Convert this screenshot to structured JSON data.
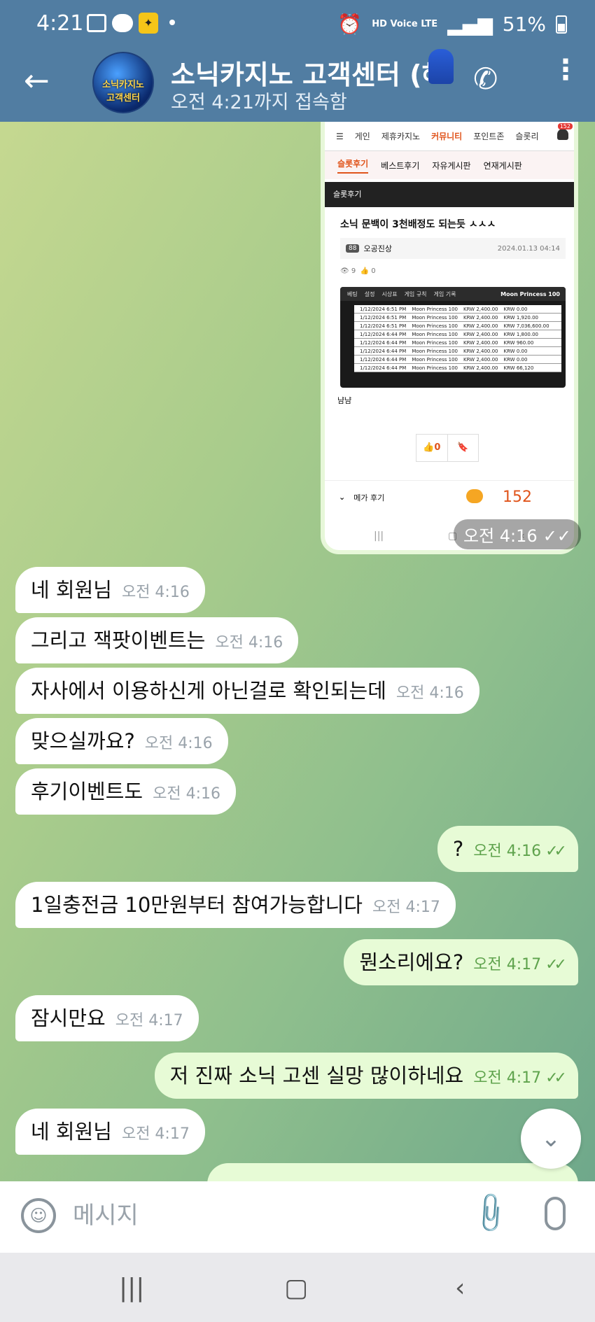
{
  "status_bar": {
    "time": "4:21",
    "network": "HD Voice LTE",
    "battery": "51%"
  },
  "header": {
    "back_icon": "arrow-left-icon",
    "avatar_text": "소닉카지노 고객센터",
    "title": "소닉카지노 고객센터 (해",
    "subtitle": "오전 4:21까지 접속함"
  },
  "shared_screenshot": {
    "nav_items": [
      "게인",
      "제휴카지노",
      "커뮤니티",
      "포인트존",
      "슬롯리"
    ],
    "nav_active": "커뮤니티",
    "notif_count": "152",
    "tabs": [
      "슬롯후기",
      "베스트후기",
      "자유게시판",
      "연재게시판"
    ],
    "tab_active": "슬롯후기",
    "section": "슬롯후기",
    "post_title": "소닉 문백이 3천배정도 되는듯 ㅅㅅㅅ",
    "author_level": "88",
    "author": "오공진상",
    "date": "2024.01.13 04:14",
    "views": "9",
    "likes": "0",
    "game_tabs": [
      "베팅",
      "설정",
      "시상표",
      "게임 규칙",
      "게임 기록"
    ],
    "game_title": "Moon Princess 100",
    "game_rows": [
      {
        "time": "1/12/2024 6:51 PM",
        "game": "Moon Princess 100",
        "bet": "KRW 2,400.00",
        "win": "KRW 0.00"
      },
      {
        "time": "1/12/2024 6:51 PM",
        "game": "Moon Princess 100",
        "bet": "KRW 2,400.00",
        "win": "KRW 1,920.00"
      },
      {
        "time": "1/12/2024 6:51 PM",
        "game": "Moon Princess 100",
        "bet": "KRW 2,400.00",
        "win": "KRW 7,036,600.00"
      },
      {
        "time": "1/12/2024 6:44 PM",
        "game": "Moon Princess 100",
        "bet": "KRW 2,400.00",
        "win": "KRW 1,800.00"
      },
      {
        "time": "1/12/2024 6:44 PM",
        "game": "Moon Princess 100",
        "bet": "KRW 2,400.00",
        "win": "KRW 960.00"
      },
      {
        "time": "1/12/2024 6:44 PM",
        "game": "Moon Princess 100",
        "bet": "KRW 2,400.00",
        "win": "KRW 0.00"
      },
      {
        "time": "1/12/2024 6:44 PM",
        "game": "Moon Princess 100",
        "bet": "KRW 2,400.00",
        "win": "KRW 0.00"
      },
      {
        "time": "1/12/2024 6:44 PM",
        "game": "Moon Princess 100",
        "bet": "KRW 2,400.00",
        "win": "KRW 66,120"
      }
    ],
    "reply": "냠냠",
    "like_count": "0",
    "footer_label": "메가 후기",
    "comment_count": "152",
    "timestamp": "오전 4:16"
  },
  "messages": [
    {
      "dir": "in",
      "text": "네 회원님",
      "time": "오전 4:16"
    },
    {
      "dir": "in",
      "text": "그리고 잭팟이벤트는",
      "time": "오전 4:16"
    },
    {
      "dir": "in",
      "text": "자사에서 이용하신게 아닌걸로 확인되는데",
      "time": "오전 4:16"
    },
    {
      "dir": "in",
      "text": "맞으실까요?",
      "time": "오전 4:16"
    },
    {
      "dir": "in",
      "text": "후기이벤트도",
      "time": "오전 4:16"
    },
    {
      "dir": "out",
      "text": "?",
      "time": "오전 4:16"
    },
    {
      "dir": "in",
      "text": "1일충전금 10만원부터 참여가능합니다",
      "time": "오전 4:17"
    },
    {
      "dir": "out",
      "text": "뭔소리에요?",
      "time": "오전 4:17"
    },
    {
      "dir": "in",
      "text": "잠시만요",
      "time": "오전 4:17"
    },
    {
      "dir": "out",
      "text": "저 진짜 소닉 고센 실망 많이하네요",
      "time": "오전 4:17"
    },
    {
      "dir": "in",
      "text": "네 회원님",
      "time": "오전 4:17"
    }
  ],
  "input": {
    "placeholder": "메시지"
  },
  "icons": {
    "emoji": "emoji-icon",
    "attach": "paperclip-icon",
    "mic": "microphone-icon",
    "scroll_down": "chevron-down-icon"
  },
  "colors": {
    "header": "#517da2",
    "outgoing_bubble": "#e7fbd6",
    "incoming_bubble": "#ffffff",
    "accent_orange": "#e0541b"
  }
}
